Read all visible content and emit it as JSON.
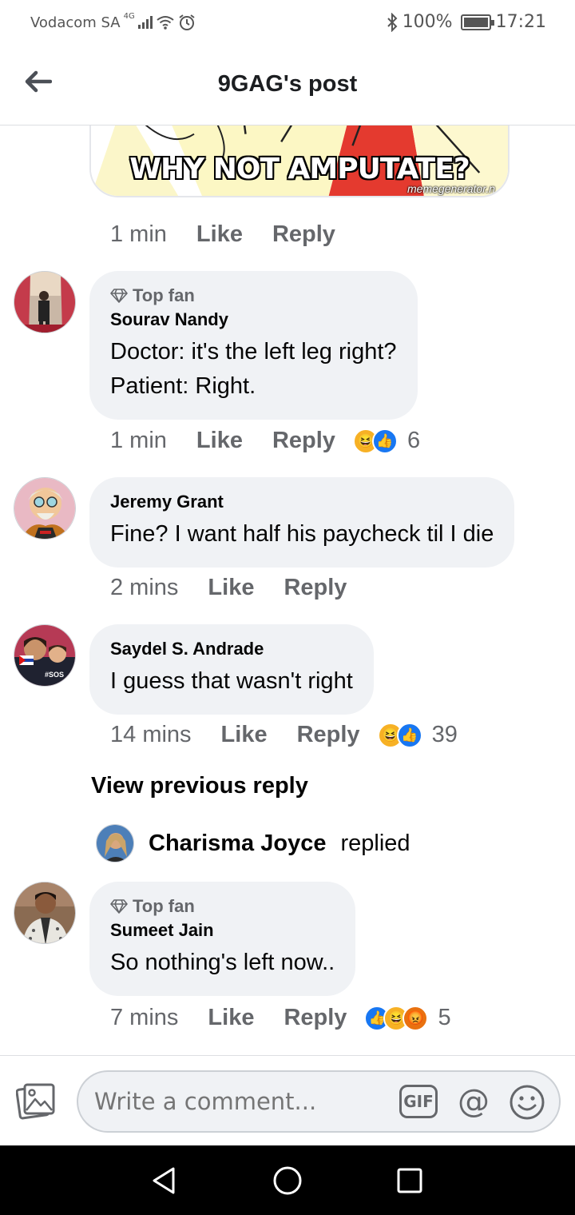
{
  "status_bar": {
    "carrier": "Vodacom SA",
    "network": "4G",
    "battery": "100%",
    "battery_level": 1.0,
    "time": "17:21"
  },
  "header": {
    "title": "9GAG's post",
    "back_icon": "arrow-left-icon"
  },
  "meme": {
    "caption": "WHY NOT AMPUTATE?",
    "watermark": "memegenerator.n"
  },
  "post_actions": {
    "time": "1 min",
    "like": "Like",
    "reply": "Reply"
  },
  "comments": [
    {
      "badge": "Top fan",
      "author": "Sourav Nandy",
      "lines": [
        "Doctor: it's the left leg right?",
        "Patient: Right."
      ],
      "time": "1 min",
      "like": "Like",
      "reply": "Reply",
      "reactions": [
        "haha",
        "like"
      ],
      "reaction_count": "6"
    },
    {
      "badge": "",
      "author": "Jeremy Grant",
      "lines": [
        "Fine? I want half his paycheck til I die"
      ],
      "time": "2 mins",
      "like": "Like",
      "reply": "Reply",
      "reactions": [],
      "reaction_count": ""
    },
    {
      "badge": "",
      "author": "Saydel S. Andrade",
      "lines": [
        "I guess that wasn't right"
      ],
      "time": "14 mins",
      "like": "Like",
      "reply": "Reply",
      "reactions": [
        "haha",
        "like"
      ],
      "reaction_count": "39",
      "avatar_tag": "#SOS"
    },
    {
      "badge": "Top fan",
      "author": "Sumeet Jain",
      "lines": [
        "So nothing's left now.."
      ],
      "time": "7 mins",
      "like": "Like",
      "reply": "Reply",
      "reactions": [
        "like",
        "haha",
        "angry"
      ],
      "reaction_count": "5"
    }
  ],
  "view_previous": "View previous reply",
  "replied": {
    "name": "Charisma Joyce",
    "word": "replied"
  },
  "composer": {
    "placeholder": "Write a comment...",
    "gif": "GIF",
    "mention": "@"
  },
  "colors": {
    "bubble": "#f0f2f5",
    "secondary_text": "#65676b",
    "like_blue": "#1877f2",
    "haha_yellow": "#f7b125",
    "angry_orange": "#e9710f"
  }
}
